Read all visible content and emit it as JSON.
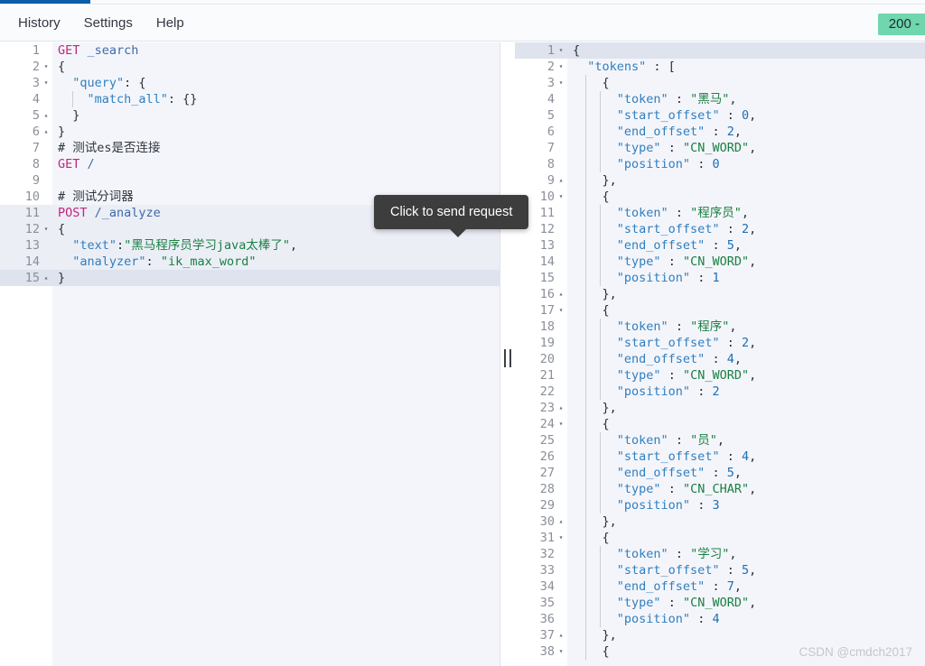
{
  "window": {
    "progress_bar_color": "#0a5fa8",
    "background": "#ffffff"
  },
  "menubar": {
    "items": [
      {
        "label": "History"
      },
      {
        "label": "Settings"
      },
      {
        "label": "Help"
      }
    ],
    "status_badge": {
      "label": "200 -",
      "color": "#6fd6ad"
    }
  },
  "tooltip": {
    "text": "Click to send request"
  },
  "actions": {
    "play_label": "play-request",
    "wrench_label": "open-wrench-menu"
  },
  "request_editor": {
    "lines": [
      {
        "n": "1",
        "fold": "",
        "text": "GET _search"
      },
      {
        "n": "2",
        "fold": "▾",
        "text": "{"
      },
      {
        "n": "3",
        "fold": "▾",
        "text": "  \"query\": {"
      },
      {
        "n": "4",
        "fold": "",
        "text": "    \"match_all\": {}"
      },
      {
        "n": "5",
        "fold": "▴",
        "text": "  }"
      },
      {
        "n": "6",
        "fold": "▴",
        "text": "}"
      },
      {
        "n": "7",
        "fold": "",
        "text": "# 测试es是否连接"
      },
      {
        "n": "8",
        "fold": "",
        "text": "GET /"
      },
      {
        "n": "9",
        "fold": "",
        "text": ""
      },
      {
        "n": "10",
        "fold": "",
        "text": "# 测试分词器"
      },
      {
        "n": "11",
        "fold": "",
        "text": "POST /_analyze"
      },
      {
        "n": "12",
        "fold": "▾",
        "text": "{"
      },
      {
        "n": "13",
        "fold": "",
        "text": "  \"text\":\"黑马程序员学习java太棒了\","
      },
      {
        "n": "14",
        "fold": "",
        "text": "  \"analyzer\": \"ik_max_word\""
      },
      {
        "n": "15",
        "fold": "▴",
        "text": "}"
      }
    ]
  },
  "response_viewer": {
    "lines": [
      {
        "n": "1",
        "fold": "▾",
        "text": "{"
      },
      {
        "n": "2",
        "fold": "▾",
        "text": "  \"tokens\" : ["
      },
      {
        "n": "3",
        "fold": "▾",
        "text": "    {"
      },
      {
        "n": "4",
        "fold": "",
        "text": "      \"token\" : \"黑马\","
      },
      {
        "n": "5",
        "fold": "",
        "text": "      \"start_offset\" : 0,"
      },
      {
        "n": "6",
        "fold": "",
        "text": "      \"end_offset\" : 2,"
      },
      {
        "n": "7",
        "fold": "",
        "text": "      \"type\" : \"CN_WORD\","
      },
      {
        "n": "8",
        "fold": "",
        "text": "      \"position\" : 0"
      },
      {
        "n": "9",
        "fold": "▴",
        "text": "    },"
      },
      {
        "n": "10",
        "fold": "▾",
        "text": "    {"
      },
      {
        "n": "11",
        "fold": "",
        "text": "      \"token\" : \"程序员\","
      },
      {
        "n": "12",
        "fold": "",
        "text": "      \"start_offset\" : 2,"
      },
      {
        "n": "13",
        "fold": "",
        "text": "      \"end_offset\" : 5,"
      },
      {
        "n": "14",
        "fold": "",
        "text": "      \"type\" : \"CN_WORD\","
      },
      {
        "n": "15",
        "fold": "",
        "text": "      \"position\" : 1"
      },
      {
        "n": "16",
        "fold": "▴",
        "text": "    },"
      },
      {
        "n": "17",
        "fold": "▾",
        "text": "    {"
      },
      {
        "n": "18",
        "fold": "",
        "text": "      \"token\" : \"程序\","
      },
      {
        "n": "19",
        "fold": "",
        "text": "      \"start_offset\" : 2,"
      },
      {
        "n": "20",
        "fold": "",
        "text": "      \"end_offset\" : 4,"
      },
      {
        "n": "21",
        "fold": "",
        "text": "      \"type\" : \"CN_WORD\","
      },
      {
        "n": "22",
        "fold": "",
        "text": "      \"position\" : 2"
      },
      {
        "n": "23",
        "fold": "▴",
        "text": "    },"
      },
      {
        "n": "24",
        "fold": "▾",
        "text": "    {"
      },
      {
        "n": "25",
        "fold": "",
        "text": "      \"token\" : \"员\","
      },
      {
        "n": "26",
        "fold": "",
        "text": "      \"start_offset\" : 4,"
      },
      {
        "n": "27",
        "fold": "",
        "text": "      \"end_offset\" : 5,"
      },
      {
        "n": "28",
        "fold": "",
        "text": "      \"type\" : \"CN_CHAR\","
      },
      {
        "n": "29",
        "fold": "",
        "text": "      \"position\" : 3"
      },
      {
        "n": "30",
        "fold": "▴",
        "text": "    },"
      },
      {
        "n": "31",
        "fold": "▾",
        "text": "    {"
      },
      {
        "n": "32",
        "fold": "",
        "text": "      \"token\" : \"学习\","
      },
      {
        "n": "33",
        "fold": "",
        "text": "      \"start_offset\" : 5,"
      },
      {
        "n": "34",
        "fold": "",
        "text": "      \"end_offset\" : 7,"
      },
      {
        "n": "35",
        "fold": "",
        "text": "      \"type\" : \"CN_WORD\","
      },
      {
        "n": "36",
        "fold": "",
        "text": "      \"position\" : 4"
      },
      {
        "n": "37",
        "fold": "▴",
        "text": "    },"
      },
      {
        "n": "38",
        "fold": "▾",
        "text": "    {"
      }
    ]
  },
  "watermark": {
    "text": "CSDN @cmdch2017"
  }
}
